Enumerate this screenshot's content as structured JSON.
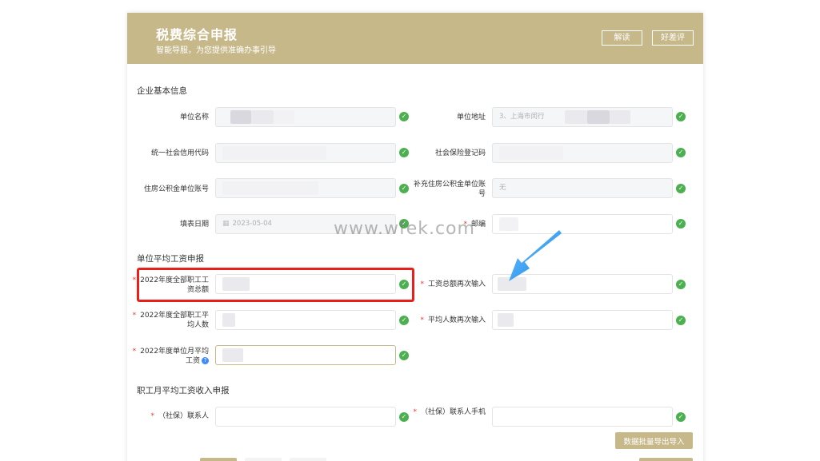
{
  "header": {
    "title": "税费综合申报",
    "subtitle": "智能导服，为您提供准确办事引导",
    "read_label": "解读",
    "rate_label": "好差评",
    "bg_color": "#c7b88a"
  },
  "sections": {
    "basic_info": "企业基本信息",
    "avg_wage": "单位平均工资申报",
    "monthly_wage": "职工月平均工资收入申报"
  },
  "basic": {
    "unit_name_label": "单位名称",
    "unit_address_label": "单位地址",
    "unit_address_value": "3、上海市闵行",
    "credit_code_label": "统一社会信用代码",
    "social_reg_label": "社会保险登记码",
    "housing_fund_label": "住房公积金单位账号",
    "supp_housing_label": "补充住房公积金单位账号",
    "supp_housing_value": "无",
    "fill_date_label": "填表日期",
    "fill_date_value": "2023-05-04",
    "postcode_label": "邮编",
    "required_mark": "*"
  },
  "wage": {
    "total_wage_label": "2022年度全部职工工资总额",
    "total_wage_confirm_label": "工资总额再次输入",
    "avg_staff_label": "2022年度全部职工平均人数",
    "avg_staff_confirm_label": "平均人数再次输入",
    "monthly_avg_label": "2022年度单位月平均工资",
    "help_icon": "?"
  },
  "monthly": {
    "contact_label": "（社保）联系人",
    "contact_phone_label": "（社保）联系人手机"
  },
  "import_button_label": "数据批量导出导入",
  "watermark": "www.wfek.com",
  "check_mark": "✓",
  "colors": {
    "accent": "#c7b88a",
    "check": "#4caf50",
    "highlight": "#e8201a",
    "arrow": "#2196f3",
    "required": "#e53935"
  }
}
